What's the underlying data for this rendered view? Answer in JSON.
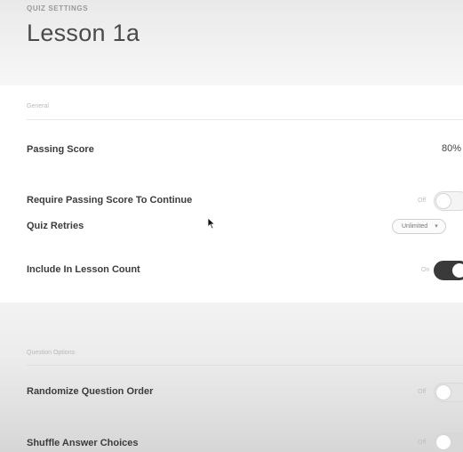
{
  "header": {
    "kicker": "QUIZ SETTINGS",
    "title": "Lesson 1a"
  },
  "sections": {
    "general_label": "General",
    "question_options_label": "Question Options"
  },
  "rows": {
    "passing_score": {
      "label": "Passing Score",
      "value": "80%"
    },
    "require_passing": {
      "label": "Require Passing Score To Continue",
      "state_label": "Off",
      "on": false
    },
    "quiz_retries": {
      "label": "Quiz Retries",
      "selected": "Unlimited",
      "caret": "▾"
    },
    "include_in_count": {
      "label": "Include In Lesson Count",
      "state_label": "On",
      "on": true
    },
    "randomize_order": {
      "label": "Randomize Question Order",
      "state_label": "Off",
      "on": false
    },
    "shuffle_answers": {
      "label": "Shuffle Answer Choices",
      "state_label": "Off",
      "on": false
    }
  },
  "colors": {
    "toggle_on": "#3a3a3a",
    "toggle_off": "#f4f4f4"
  }
}
